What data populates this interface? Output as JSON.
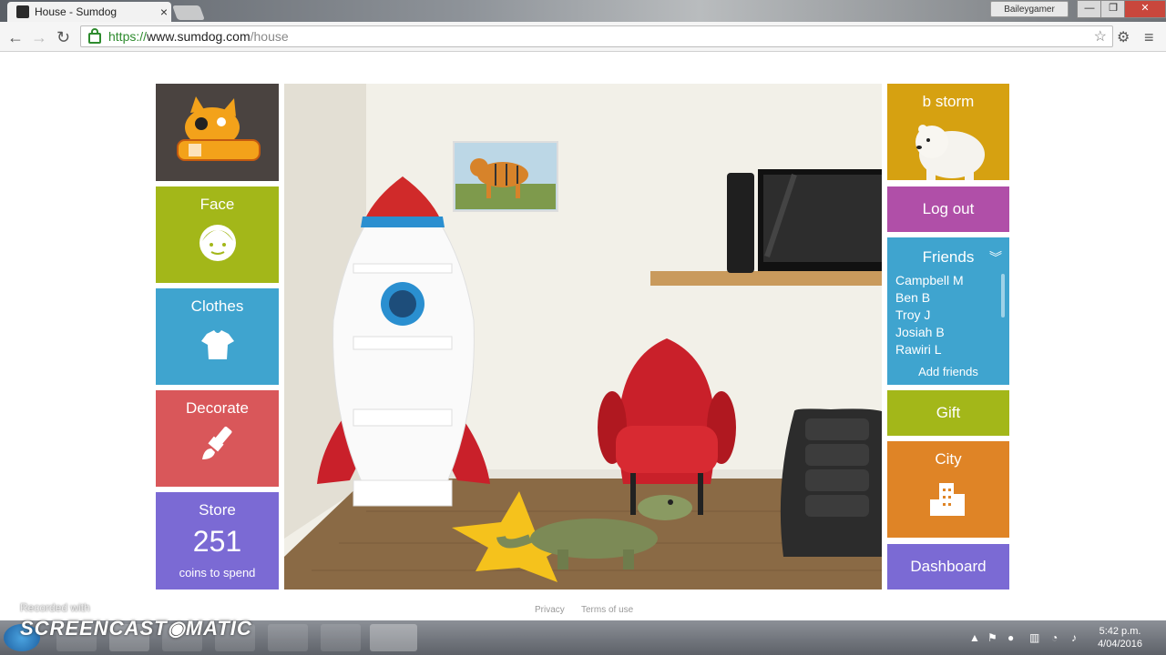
{
  "browser": {
    "tab_title": "House - Sumdog",
    "tab_close": "×",
    "user_name": "Baileygamer",
    "url_scheme": "https://",
    "url_host": "www.sumdog.com",
    "url_path": "/house",
    "window_controls": [
      "—",
      "❐",
      "✕"
    ]
  },
  "menu_left": {
    "face_label": "Face",
    "clothes_label": "Clothes",
    "decorate_label": "Decorate",
    "store_label": "Store",
    "store_coins": "251",
    "store_sub": "coins to spend"
  },
  "menu_right": {
    "user_display": "b storm",
    "logout_label": "Log out",
    "friends_label": "Friends",
    "friends": [
      "Campbell M",
      "Ben B",
      "Troy J",
      "Josiah B",
      "Rawiri L"
    ],
    "add_friends_label": "Add friends",
    "gift_label": "Gift",
    "city_label": "City",
    "dashboard_label": "Dashboard"
  },
  "footer": {
    "privacy": "Privacy",
    "terms": "Terms of use"
  },
  "overlay": {
    "recorded_with": "Recorded with",
    "screencast": "SCREENCAST◉MATIC"
  },
  "taskbar": {
    "time": "5:42 p.m.",
    "date": "4/04/2016"
  },
  "colors": {
    "green": "#a3b719",
    "blue": "#3fa4cf",
    "red": "#d9575a",
    "purple": "#7b6ad4",
    "gold": "#d6a111",
    "magenta": "#b04fa8",
    "orange": "#df8426"
  }
}
